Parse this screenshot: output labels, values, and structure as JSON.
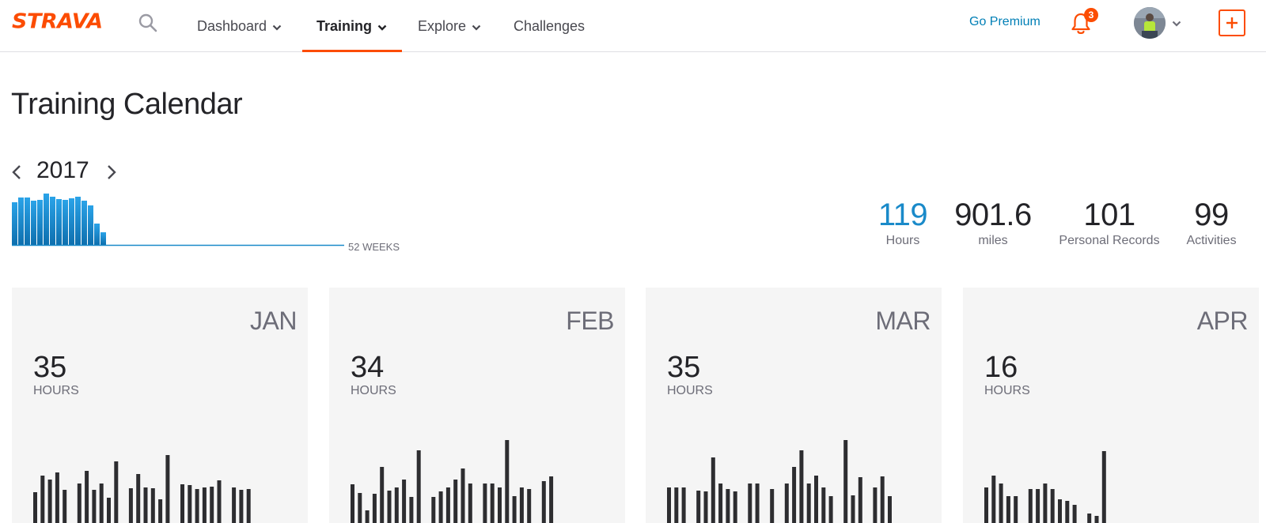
{
  "brand": {
    "logo_text": "STRAVA",
    "accent": "#fc4c02",
    "link": "#007fb6",
    "chart_blue": "#1a8ac9"
  },
  "nav": {
    "items": [
      {
        "label": "Dashboard",
        "has_menu": true
      },
      {
        "label": "Training",
        "has_menu": true,
        "active": true
      },
      {
        "label": "Explore",
        "has_menu": true
      },
      {
        "label": "Challenges",
        "has_menu": false
      }
    ],
    "premium_label": "Go Premium",
    "notification_count": "3",
    "icons": [
      "search-icon",
      "bell-icon",
      "avatar",
      "chevron-down-icon",
      "plus-icon"
    ]
  },
  "page": {
    "title": "Training Calendar",
    "year": "2017",
    "weeks_label": "52 WEEKS"
  },
  "stats": [
    {
      "value": "119",
      "label": "Hours"
    },
    {
      "value": "901.6",
      "label": "miles"
    },
    {
      "value": "101",
      "label": "Personal Records"
    },
    {
      "value": "99",
      "label": "Activities"
    }
  ],
  "chart_data": [
    {
      "type": "bar",
      "name": "weekly",
      "total_weeks": 52,
      "values": [
        54,
        60,
        60,
        56,
        57,
        65,
        61,
        58,
        57,
        59,
        61,
        56,
        50,
        27,
        16
      ]
    },
    {
      "type": "bar",
      "name": "JAN",
      "values": [
        39,
        60,
        55,
        64,
        42,
        0,
        50,
        66,
        42,
        50,
        32,
        78,
        0,
        44,
        62,
        45,
        44,
        30,
        86,
        0,
        49,
        48,
        43,
        45,
        46,
        54,
        0,
        45,
        42,
        43
      ]
    },
    {
      "type": "bar",
      "name": "FEB",
      "values": [
        49,
        38,
        16,
        37,
        71,
        41,
        45,
        55,
        33,
        92,
        0,
        33,
        40,
        45,
        55,
        69,
        50,
        0,
        50,
        50,
        45,
        105,
        34,
        45,
        43,
        0,
        53,
        59
      ]
    },
    {
      "type": "bar",
      "name": "MAR",
      "values": [
        45,
        45,
        45,
        0,
        41,
        40,
        83,
        50,
        43,
        40,
        0,
        50,
        50,
        0,
        43,
        0,
        50,
        71,
        92,
        50,
        60,
        45,
        34,
        0,
        105,
        35,
        58,
        0,
        45,
        59,
        34
      ]
    },
    {
      "type": "bar",
      "name": "APR",
      "values": [
        45,
        60,
        50,
        34,
        34,
        0,
        43,
        43,
        50,
        43,
        30,
        28,
        23,
        0,
        12,
        9,
        91
      ]
    }
  ],
  "months": [
    {
      "name": "JAN",
      "hours": "35",
      "hours_label": "HOURS"
    },
    {
      "name": "FEB",
      "hours": "34",
      "hours_label": "HOURS"
    },
    {
      "name": "MAR",
      "hours": "35",
      "hours_label": "HOURS"
    },
    {
      "name": "APR",
      "hours": "16",
      "hours_label": "HOURS"
    }
  ]
}
